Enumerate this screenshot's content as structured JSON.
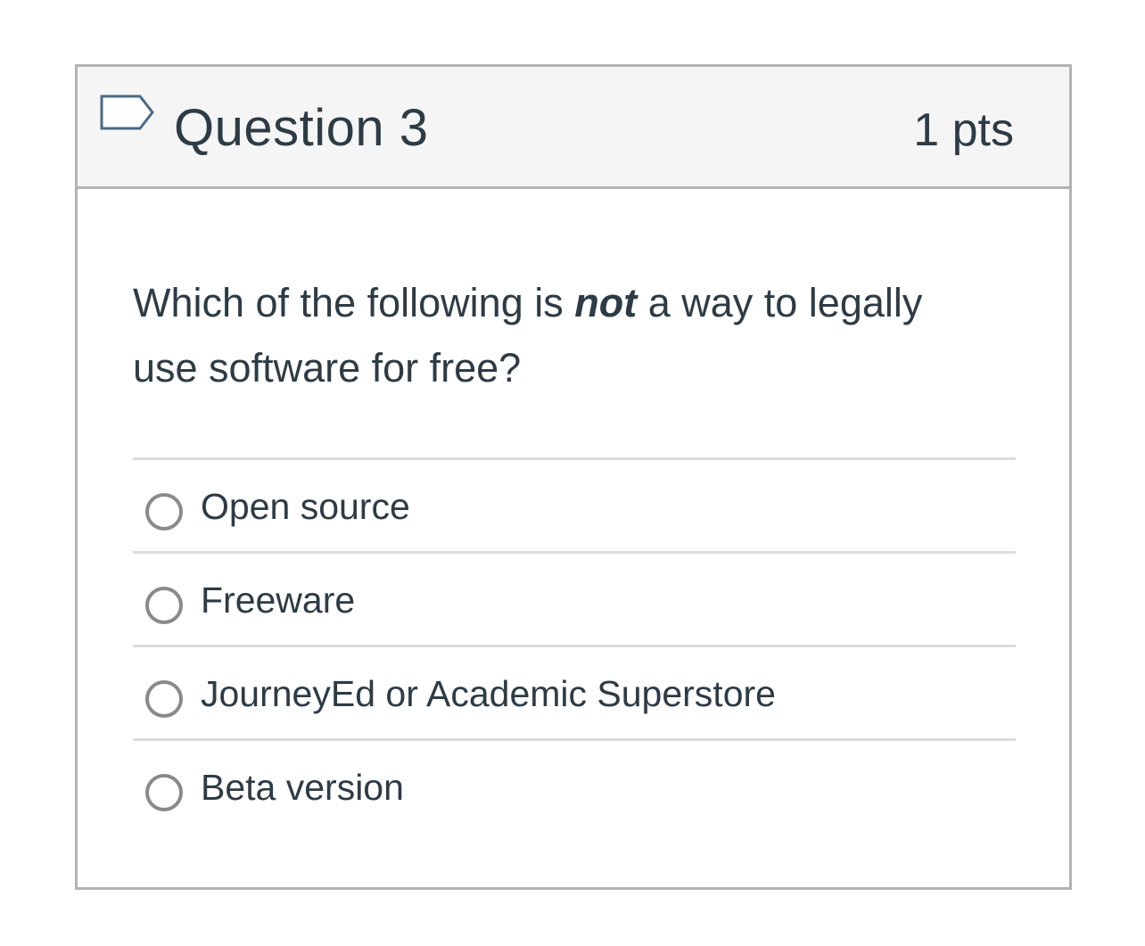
{
  "question": {
    "title": "Question 3",
    "points": "1 pts",
    "flag_icon": "flag-outline-icon",
    "text_before": "Which of the following is ",
    "text_emphasis": "not",
    "text_after": " a way to legally use software for free?"
  },
  "answers": [
    {
      "label": "Open source",
      "selected": false
    },
    {
      "label": "Freeware",
      "selected": false
    },
    {
      "label": "JourneyEd or Academic Superstore",
      "selected": false
    },
    {
      "label": "Beta version",
      "selected": false
    }
  ],
  "colors": {
    "text": "#2d3b45",
    "header_bg": "#f5f5f5",
    "border": "#b3b3b3",
    "divider": "#dcdcdc",
    "radio_border": "#8a8a8a",
    "flag_stroke": "#4a6a85"
  }
}
